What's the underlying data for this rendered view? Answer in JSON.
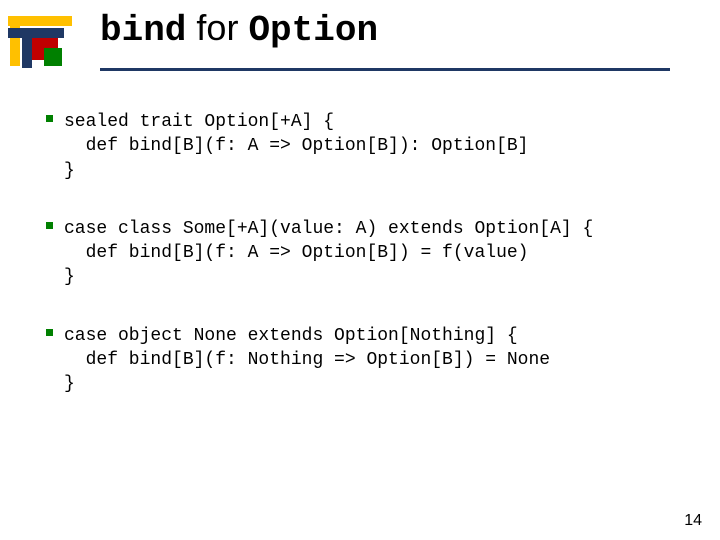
{
  "title": {
    "part1_mono": "bind",
    "part2_serif": " for ",
    "part3_mono": "Option"
  },
  "blocks": [
    "sealed trait Option[+A] {\n  def bind[B](f: A => Option[B]): Option[B]\n}",
    "case class Some[+A](value: A) extends Option[A] {\n  def bind[B](f: A => Option[B]) = f(value)\n}",
    "case object None extends Option[Nothing] {\n  def bind[B](f: Nothing => Option[B]) = None\n}"
  ],
  "pageNumber": "14"
}
